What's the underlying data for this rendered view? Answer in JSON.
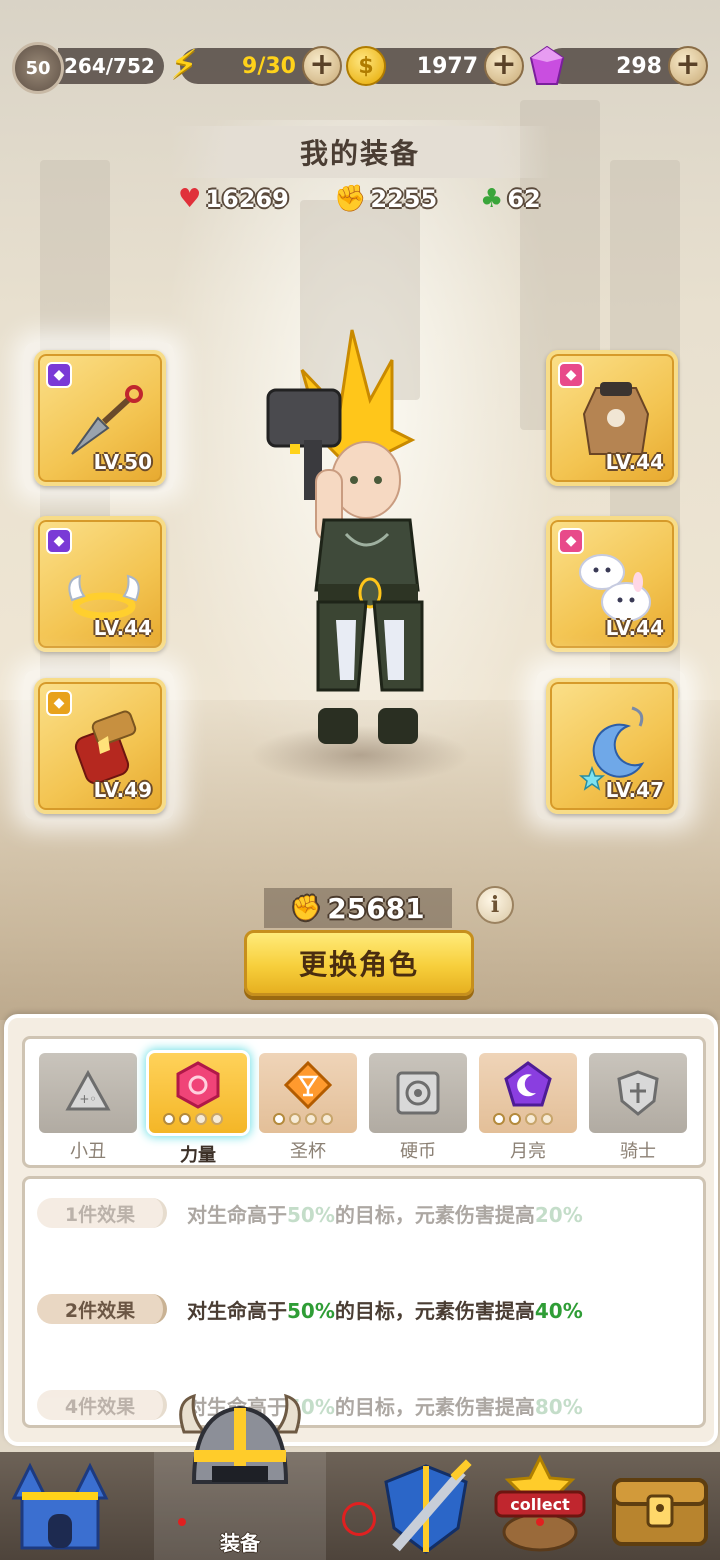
{
  "topbar": {
    "level": "50",
    "xp": "264/752",
    "energy": "9/30",
    "gold": "1977",
    "gems": "298",
    "plus": "+"
  },
  "title": "我的装备",
  "stats": {
    "hp": "16269",
    "attack": "2255",
    "luck": "62"
  },
  "slots": {
    "left": [
      {
        "level": "LV.50",
        "gem_color": "#7a3ad6",
        "item": "kunai-icon"
      },
      {
        "level": "LV.44",
        "gem_color": "#7a3ad6",
        "item": "winged-halo-icon"
      },
      {
        "level": "LV.49",
        "gem_color": "#e8a21c",
        "item": "gauntlet-icon"
      }
    ],
    "right": [
      {
        "level": "LV.44",
        "gem_color": "#e84a8a",
        "item": "fur-coat-icon"
      },
      {
        "level": "LV.44",
        "gem_color": "#e84a8a",
        "item": "bunny-slippers-icon"
      },
      {
        "level": "LV.47",
        "gem_color": "#e8a21c",
        "item": "moon-earring-icon"
      }
    ]
  },
  "power": "25681",
  "info": "i",
  "change_button": "更换角色",
  "set_tabs": [
    {
      "label": "小丑",
      "icon": "clown-triangle-icon",
      "dots": 0
    },
    {
      "label": "力量",
      "icon": "power-hexagon-icon",
      "dots": 4,
      "active": true
    },
    {
      "label": "圣杯",
      "icon": "grail-icon",
      "dots": 4
    },
    {
      "label": "硬币",
      "icon": "coin-square-icon",
      "dots": 0
    },
    {
      "label": "月亮",
      "icon": "moon-pentagon-icon",
      "dots": 4
    },
    {
      "label": "骑士",
      "icon": "knight-shield-icon",
      "dots": 0
    }
  ],
  "effects": [
    {
      "label": "1件效果",
      "pre": "对生命高于",
      "v1": "50%",
      "mid": "的目标，元素伤害提高",
      "v2": "20%",
      "dim": true
    },
    {
      "label": "2件效果",
      "pre": "对生命高于",
      "v1": "50%",
      "mid": "的目标，元素伤害提高",
      "v2": "40%",
      "dim": false
    },
    {
      "label": "4件效果",
      "pre": "对生命高于",
      "v1": "50%",
      "mid": "的目标，元素伤害提高",
      "v2": "80%",
      "dim": true
    }
  ],
  "nav": {
    "equipment_label": "装备",
    "collect_label": "collect"
  },
  "colors": {
    "highlight_green": "#2f9d36",
    "button_gold": "#f7cf3c",
    "active_glow": "#6fe0e6"
  }
}
